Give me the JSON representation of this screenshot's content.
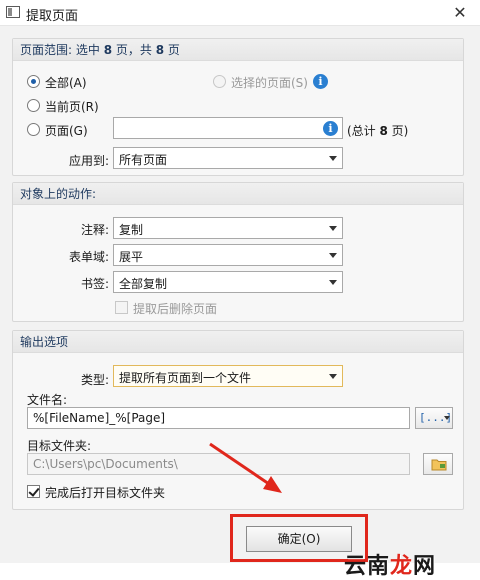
{
  "window": {
    "title": "提取页面",
    "close_glyph": "✕"
  },
  "page_range": {
    "header_prefix": "页面范围: 选中 ",
    "selected_count": "8",
    "header_mid": " 页，共 ",
    "total_count": "8",
    "header_suffix": " 页",
    "options": {
      "all": "全部(A)",
      "selected_pages": "选择的页面(S)",
      "current_page": "当前页(R)",
      "pages": "页面(G)"
    },
    "selected_option": "all",
    "pages_value": "",
    "total_prefix": "(总计 ",
    "total_num": "8",
    "total_suffix": " 页)",
    "apply_to_label": "应用到:",
    "apply_to_value": "所有页面"
  },
  "object_actions": {
    "header": "对象上的动作:",
    "annotations_label": "注释:",
    "annotations_value": "复制",
    "form_fields_label": "表单域:",
    "form_fields_value": "展平",
    "bookmarks_label": "书签:",
    "bookmarks_value": "全部复制",
    "delete_after_label": "提取后删除页面"
  },
  "output": {
    "header": "输出选项",
    "type_label": "类型:",
    "type_value": "提取所有页面到一个文件",
    "filename_label": "文件名:",
    "filename_value": "%[FileName]_%[Page]",
    "macro_button_glyph": "[...]",
    "target_folder_label": "目标文件夹:",
    "target_folder_value": "C:\\Users\\pc\\Documents\\",
    "open_after_label": "完成后打开目标文件夹"
  },
  "footer": {
    "ok_label": "确定(O)"
  },
  "watermark": {
    "text_a": "云南",
    "text_b": "龙",
    "text_c": "网"
  },
  "colors": {
    "accent_blue": "#2a7fd1",
    "highlight_red": "#e0271c",
    "dropdown_highlight": "#e2b95b"
  }
}
